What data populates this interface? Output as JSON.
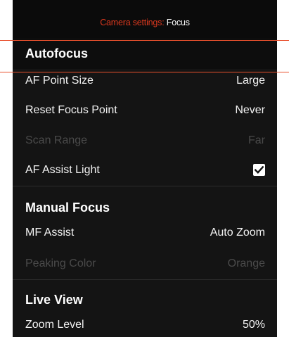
{
  "header": {
    "prefix": "Camera settings:",
    "title": "Focus"
  },
  "sections": [
    {
      "title": "Autofocus",
      "rows": [
        {
          "label": "AF Point Size",
          "value": "Large",
          "enabled": true
        },
        {
          "label": "Reset Focus Point",
          "value": "Never",
          "enabled": true
        },
        {
          "label": "Scan Range",
          "value": "Far",
          "enabled": false
        },
        {
          "label": "AF Assist Light",
          "checked": true,
          "enabled": true
        }
      ]
    },
    {
      "title": "Manual Focus",
      "rows": [
        {
          "label": "MF Assist",
          "value": "Auto Zoom",
          "enabled": true
        },
        {
          "label": "Peaking Color",
          "value": "Orange",
          "enabled": false
        }
      ]
    },
    {
      "title": "Live View",
      "rows": [
        {
          "label": "Zoom Level",
          "value": "50%",
          "enabled": true
        }
      ]
    }
  ],
  "colors": {
    "accent": "#d9381e",
    "guide_line": "#e9502d",
    "background": "#141414"
  },
  "icons": {
    "checkbox": "checkmark-icon"
  }
}
